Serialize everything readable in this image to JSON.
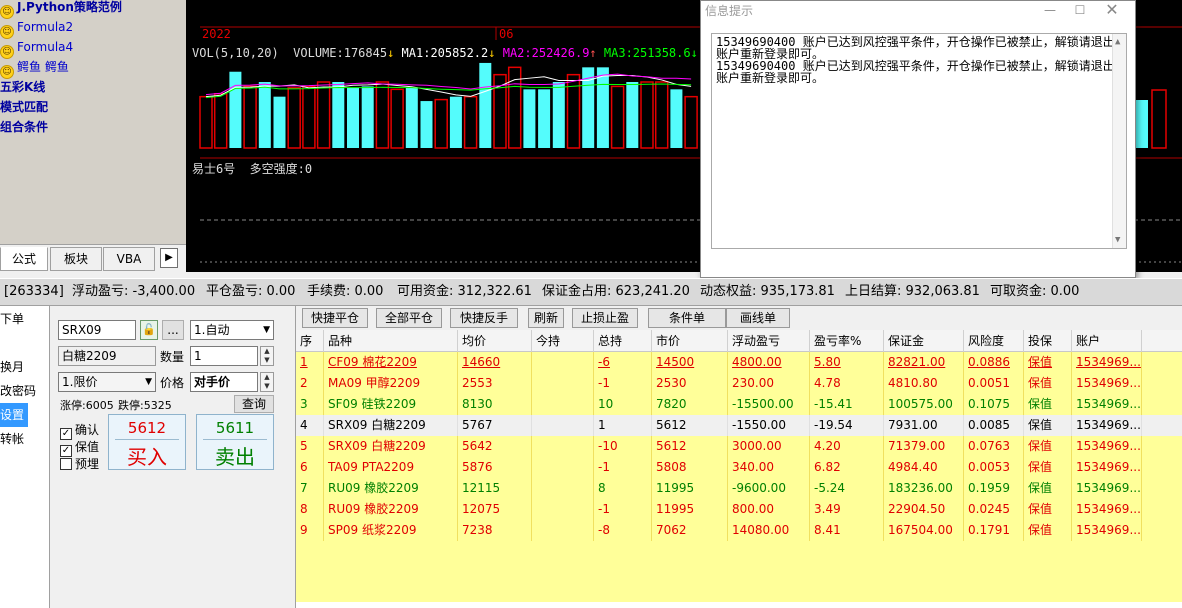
{
  "formula_tree": {
    "items": [
      {
        "label": "J.Python策略范例",
        "icon": "smile-icon",
        "style": "bold"
      },
      {
        "label": "Formula2",
        "icon": "smile-icon",
        "style": "blue"
      },
      {
        "label": "Formula4",
        "icon": "smile-icon",
        "style": "blue"
      },
      {
        "label": "鳄鱼 鳄鱼",
        "icon": "smile-icon",
        "style": "blue"
      },
      {
        "label": "五彩K线",
        "icon": "",
        "style": "bold"
      },
      {
        "label": "模式匹配",
        "icon": "",
        "style": "bold"
      },
      {
        "label": "组合条件",
        "icon": "",
        "style": "bold"
      }
    ],
    "tabs": [
      "公式",
      "板块",
      "VBA"
    ]
  },
  "chart": {
    "date_labels": [
      "2022",
      "06"
    ],
    "vol_label": "VOL(5,10,20)",
    "volume_label": "VOLUME:176845",
    "ma1": "MA1:205852.2",
    "ma2": "MA2:252426.9",
    "ma3": "MA3:251358.6",
    "indicator_label": "易士6号  多空强度:0",
    "colors": {
      "up": "#e60000",
      "down": "#54fcfc",
      "ma1": "#ffffff",
      "ma2": "#ff00ff",
      "ma3": "#00ff00"
    }
  },
  "chart_data": {
    "type": "bar",
    "title": "",
    "series": [
      {
        "name": "VOLUME",
        "values": [
          0.35,
          0.37,
          0.52,
          0.42,
          0.45,
          0.35,
          0.41,
          0.42,
          0.45,
          0.45,
          0.41,
          0.42,
          0.45,
          0.4,
          0.41,
          0.32,
          0.33,
          0.35,
          0.35,
          0.58,
          0.5,
          0.55,
          0.4,
          0.4,
          0.45,
          0.5,
          0.55,
          0.55,
          0.42,
          0.45,
          0.45,
          0.45,
          0.4,
          0.35
        ],
        "colors": [
          "up",
          "up",
          "down",
          "up",
          "down",
          "down",
          "up",
          "up",
          "up",
          "down",
          "down",
          "down",
          "up",
          "up",
          "down",
          "down",
          "up",
          "down",
          "up",
          "down",
          "up",
          "up",
          "down",
          "down",
          "down",
          "up",
          "down",
          "down",
          "up",
          "down",
          "up",
          "up",
          "down",
          "up"
        ]
      }
    ],
    "ylim": [
      0,
      0.6
    ]
  },
  "dialog": {
    "title": "信息提示",
    "messages": [
      "15349690400 账户已达到风控强平条件，开仓操作已被禁止，解锁请退出",
      "账户重新登录即可。",
      "15349690400 账户已达到风控强平条件，开仓操作已被禁止，解锁请退出",
      "账户重新登录即可。"
    ]
  },
  "account": {
    "id": "[263334]",
    "floating_pl": "浮动盈亏: -3,400.00",
    "close_pl": "平仓盈亏: 0.00",
    "fee": "手续费: 0.00",
    "available": "可用资金: 312,322.61",
    "margin": "保证金占用: 623,241.20",
    "equity": "动态权益: 935,173.81",
    "settle": "上日结算: 932,063.81",
    "withdrawable": "可取资金: 0.00"
  },
  "side_menu": [
    "下单",
    "",
    "换月",
    "改密码",
    "设置",
    "转帐"
  ],
  "order_form": {
    "contract": "SRX09",
    "contract_name": "白糖2209",
    "mode": "1.自动",
    "qty_label": "数量",
    "qty": "1",
    "price_type": "1.限价",
    "price_label": "价格",
    "price": "对手价",
    "limit_up": "涨停:6005",
    "limit_down": "跌停:5325",
    "query_btn": "查询",
    "confirm": "确认",
    "hedge": "保值",
    "precondition": "预埋",
    "buy_price": "5612",
    "buy_label": "买入",
    "sell_price": "5611",
    "sell_label": "卖出",
    "dots": "..."
  },
  "toolbar": [
    "快捷平仓",
    "全部平仓",
    "快捷反手",
    "刷新",
    "止损止盈",
    "条件单",
    "画线单"
  ],
  "positions": {
    "headers": [
      "序",
      "品种",
      "均价",
      "今持",
      "总持",
      "市价",
      "浮动盈亏",
      "盈亏率%",
      "保证金",
      "风险度",
      "投保",
      "账户"
    ],
    "rows": [
      {
        "cells": [
          "1",
          "CF09 棉花2209",
          "14660",
          "",
          "-6",
          "14500",
          "4800.00",
          "5.80",
          "82821.00",
          "0.0886",
          "保值",
          "1534969..."
        ],
        "color": "red",
        "ul": true
      },
      {
        "cells": [
          "2",
          "MA09 甲醇2209",
          "2553",
          "",
          "-1",
          "2530",
          "230.00",
          "4.78",
          "4810.80",
          "0.0051",
          "保值",
          "1534969..."
        ],
        "color": "red",
        "ul": false
      },
      {
        "cells": [
          "3",
          "SF09 硅铁2209",
          "8130",
          "",
          "10",
          "7820",
          "-15500.00",
          "-15.41",
          "100575.00",
          "0.1075",
          "保值",
          "1534969..."
        ],
        "color": "green",
        "ul": false
      },
      {
        "cells": [
          "4",
          "SRX09 白糖2209",
          "5767",
          "",
          "1",
          "5612",
          "-1550.00",
          "-19.54",
          "7931.00",
          "0.0085",
          "保值",
          "1534969..."
        ],
        "color": "black",
        "ul": false,
        "highlight": true
      },
      {
        "cells": [
          "5",
          "SRX09 白糖2209",
          "5642",
          "",
          "-10",
          "5612",
          "3000.00",
          "4.20",
          "71379.00",
          "0.0763",
          "保值",
          "1534969..."
        ],
        "color": "red",
        "ul": false
      },
      {
        "cells": [
          "6",
          "TA09 PTA2209",
          "5876",
          "",
          "-1",
          "5808",
          "340.00",
          "6.82",
          "4984.40",
          "0.0053",
          "保值",
          "1534969..."
        ],
        "color": "red",
        "ul": false
      },
      {
        "cells": [
          "7",
          "RU09 橡胶2209",
          "12115",
          "",
          "8",
          "11995",
          "-9600.00",
          "-5.24",
          "183236.00",
          "0.1959",
          "保值",
          "1534969..."
        ],
        "color": "green",
        "ul": false
      },
      {
        "cells": [
          "8",
          "RU09 橡胶2209",
          "12075",
          "",
          "-1",
          "11995",
          "800.00",
          "3.49",
          "22904.50",
          "0.0245",
          "保值",
          "1534969..."
        ],
        "color": "red",
        "ul": false
      },
      {
        "cells": [
          "9",
          "SP09 纸浆2209",
          "7238",
          "",
          "-8",
          "7062",
          "14080.00",
          "8.41",
          "167504.00",
          "0.1791",
          "保值",
          "1534969..."
        ],
        "color": "red",
        "ul": false
      }
    ]
  }
}
